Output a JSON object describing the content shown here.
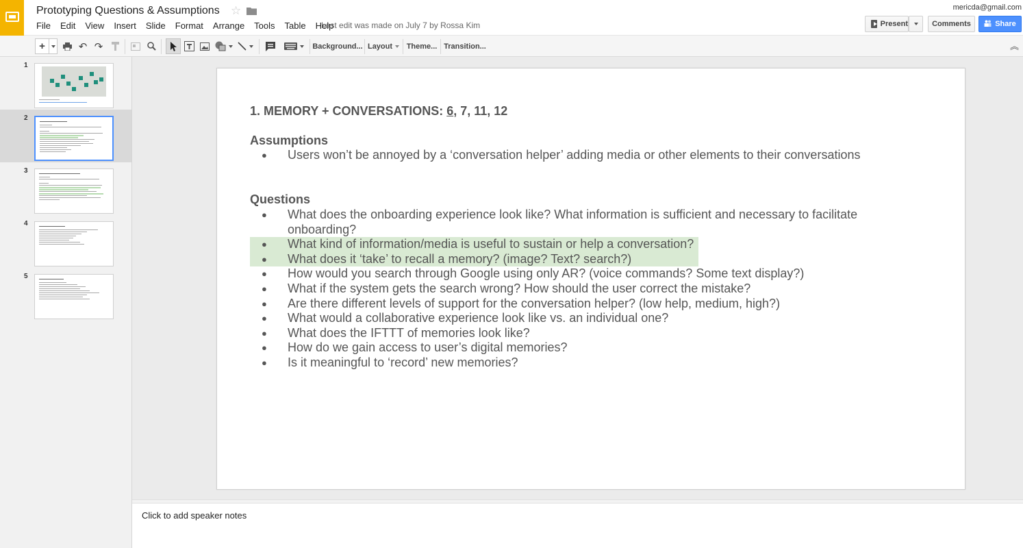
{
  "header": {
    "doc_title": "Prototyping Questions & Assumptions",
    "last_edit": "Last edit was made on July 7 by Rossa Kim",
    "account": "mericda@gmail.com",
    "present_label": "Present",
    "comments_label": "Comments",
    "share_label": "Share",
    "brand_color": "#f4b400",
    "share_color": "#4d90fe"
  },
  "menu": [
    "File",
    "Edit",
    "View",
    "Insert",
    "Slide",
    "Format",
    "Arrange",
    "Tools",
    "Table",
    "Help"
  ],
  "toolbar": {
    "new_slide": "+",
    "background": "Background...",
    "layout": "Layout",
    "theme": "Theme...",
    "transition": "Transition..."
  },
  "filmstrip": {
    "slides": [
      {
        "number": "1",
        "selected": false
      },
      {
        "number": "2",
        "selected": true
      },
      {
        "number": "3",
        "selected": false
      },
      {
        "number": "4",
        "selected": false
      },
      {
        "number": "5",
        "selected": false
      }
    ]
  },
  "slide": {
    "heading_prefix": "1. MEMORY + CONVERSATIONS: ",
    "heading_underlined": "6",
    "heading_suffix": ", 7, 11, 12",
    "assumptions_title": "Assumptions",
    "assumptions": [
      "Users won’t be annoyed by a ‘conversation helper’ adding media or other elements to their conversations"
    ],
    "questions_title": "Questions",
    "questions": [
      {
        "text": "What does the onboarding experience look like? What information is sufficient and necessary to facilitate onboarding?",
        "highlighted": false
      },
      {
        "text": "What kind of information/media is useful to sustain or help a conversation?",
        "highlighted": true
      },
      {
        "text": "What does it ‘take’ to recall a memory? (image? Text? search?)",
        "highlighted": true
      },
      {
        "text": "How would you search through Google using only AR? (voice commands? Some text display?)",
        "highlighted": false
      },
      {
        "text": "What if the system gets the search wrong? How should the user correct the mistake?",
        "highlighted": false
      },
      {
        "text": "Are there different levels of support for the conversation helper? (low help, medium, high?)",
        "highlighted": false
      },
      {
        "text": "What would a collaborative experience look like vs. an individual one?",
        "highlighted": false
      },
      {
        "text": "What does the IFTTT of memories look like?",
        "highlighted": false
      },
      {
        "text": "How do we gain access to user’s digital memories?",
        "highlighted": false
      },
      {
        "text": "Is it meaningful to ‘record’ new memories?",
        "highlighted": false
      }
    ],
    "highlight_color": "#d9ead3"
  },
  "notes": {
    "placeholder": "Click to add speaker notes"
  }
}
